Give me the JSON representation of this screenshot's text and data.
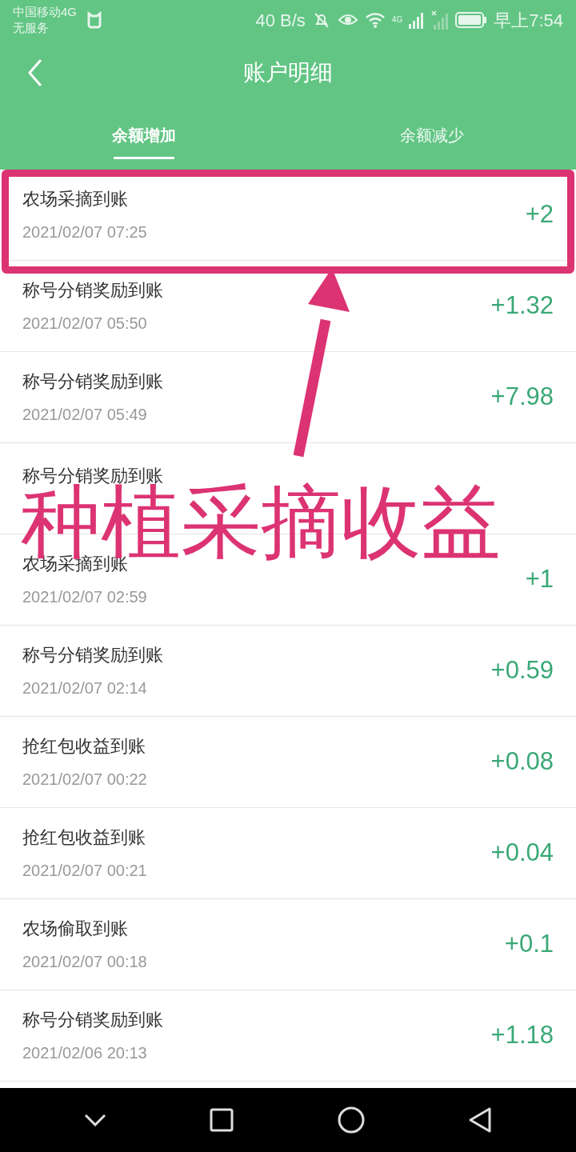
{
  "status_bar": {
    "carrier": "中国移动4G",
    "service": "无服务",
    "speed": "40 B/s",
    "network": "4G",
    "time": "早上7:54"
  },
  "header": {
    "title": "账户明细"
  },
  "tabs": [
    {
      "label": "余额增加",
      "selected": true
    },
    {
      "label": "余额减少",
      "selected": false
    }
  ],
  "records": [
    {
      "title": "农场采摘到账",
      "time": "2021/02/07 07:25",
      "amount": "+2"
    },
    {
      "title": "称号分销奖励到账",
      "time": "2021/02/07 05:50",
      "amount": "+1.32"
    },
    {
      "title": "称号分销奖励到账",
      "time": "2021/02/07 05:49",
      "amount": "+7.98"
    },
    {
      "title": "称号分销奖励到账"
    },
    {
      "title": "农场采摘到账",
      "time": "2021/02/07 02:59",
      "amount": "+1"
    },
    {
      "title": "称号分销奖励到账",
      "time": "2021/02/07 02:14",
      "amount": "+0.59"
    },
    {
      "title": "抢红包收益到账",
      "time": "2021/02/07 00:22",
      "amount": "+0.08"
    },
    {
      "title": "抢红包收益到账",
      "time": "2021/02/07 00:21",
      "amount": "+0.04"
    },
    {
      "title": "农场偷取到账",
      "time": "2021/02/07 00:18",
      "amount": "+0.1"
    },
    {
      "title": "称号分销奖励到账",
      "time": "2021/02/06 20:13",
      "amount": "+1.18"
    }
  ],
  "annotation": {
    "caption": "种植采摘收益"
  }
}
